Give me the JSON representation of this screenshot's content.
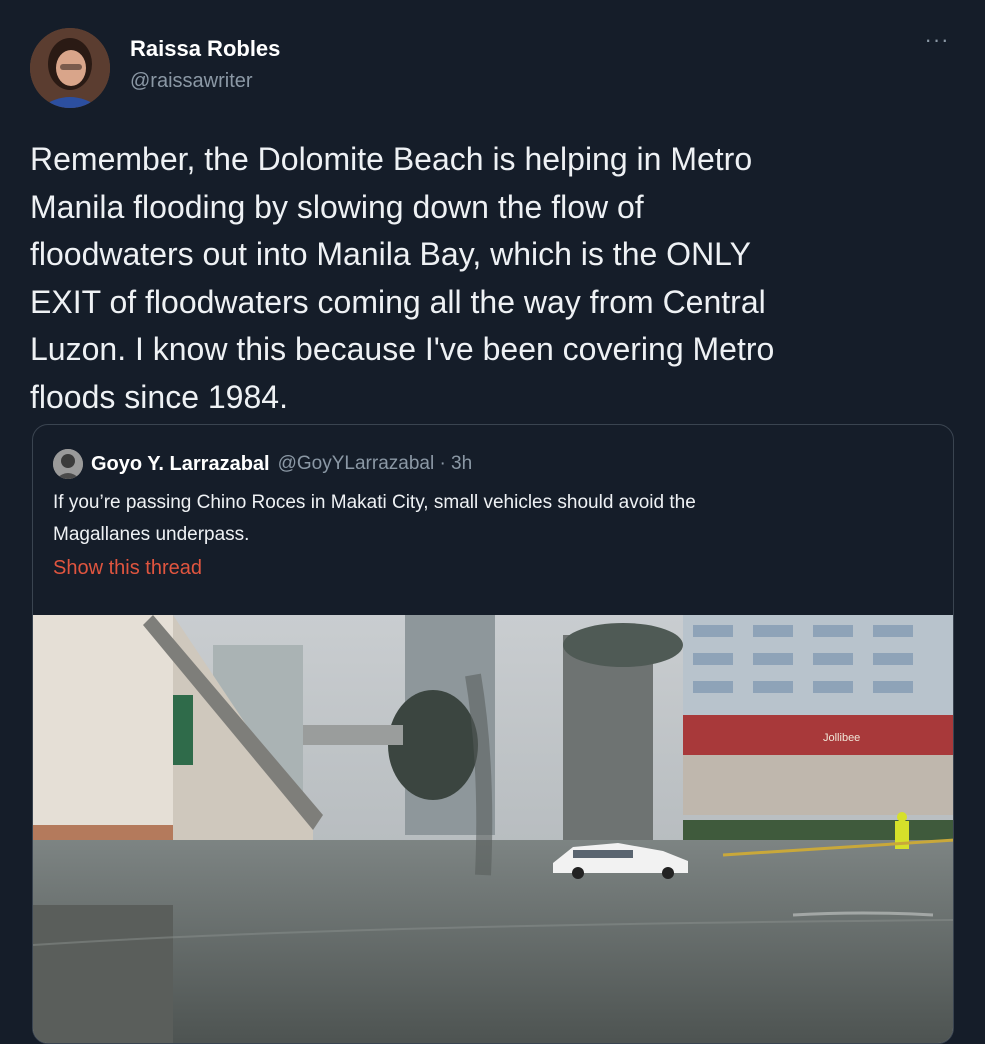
{
  "author": {
    "name": "Raissa Robles",
    "handle": "@raissawriter"
  },
  "menu": {
    "more_label": "···"
  },
  "tweet": {
    "lines": [
      "Remember, the Dolomite Beach is helping in Metro",
      "Manila flooding by slowing down the flow of",
      "floodwaters out into Manila Bay, which is the ONLY",
      "EXIT of floodwaters coming all the way from Central",
      "Luzon. I know this because I've been covering Metro",
      "floods since 1984."
    ]
  },
  "quoted_tweet": {
    "name": "Goyo Y. Larrazabal",
    "handle_time": "@GoyYLarrazabal · 3h",
    "lines": [
      "If you’re passing Chino Roces in Makati City, small vehicles should avoid the",
      "Magallanes underpass."
    ],
    "show_thread": "Show this thread",
    "media": {
      "storefront_sign": "Jollibee"
    }
  },
  "colors": {
    "background": "#151d29",
    "link_accent": "#e0553f",
    "secondary_text": "#8b98a5"
  }
}
